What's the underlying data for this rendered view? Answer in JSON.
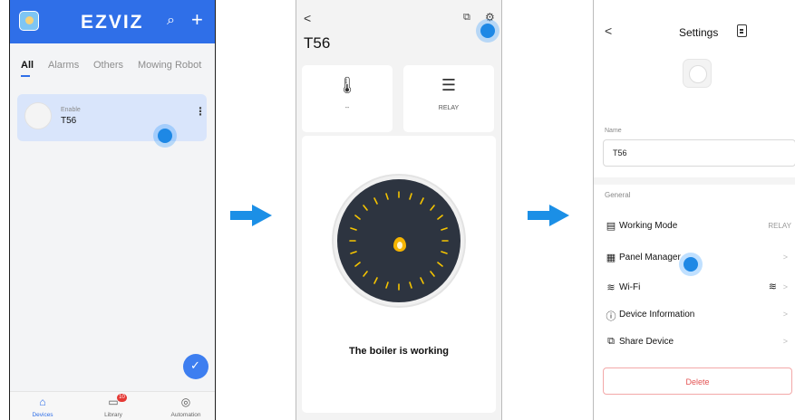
{
  "screen1": {
    "logo": "EZVIZ",
    "search_icon": "search-icon",
    "add_icon": "plus-icon",
    "tabs": [
      "All",
      "Alarms",
      "Others",
      "Mowing Robot"
    ],
    "device": {
      "status": "Enable",
      "name": "T56",
      "more": "⋮"
    },
    "nav": [
      {
        "label": "Devices",
        "icon": "home-icon"
      },
      {
        "label": "Library",
        "icon": "library-icon",
        "badge": "10"
      },
      {
        "label": "Automation",
        "icon": "compass-icon"
      }
    ]
  },
  "screen2": {
    "back": "<",
    "title": "T56",
    "tiles": [
      {
        "icon": "thermometer-icon",
        "label": "--"
      },
      {
        "icon": "sliders-icon",
        "label": "RELAY"
      }
    ],
    "status": "The boiler is working"
  },
  "screen3": {
    "back": "<",
    "title": "Settings",
    "name_label": "Name",
    "name_value": "T56",
    "section": "General",
    "rows": [
      {
        "label": "Working Mode",
        "icon": "mode-icon",
        "value": "RELAY"
      },
      {
        "label": "Panel Manager",
        "icon": "panel-icon",
        "chevron": ">"
      },
      {
        "label": "Wi-Fi",
        "icon": "wifi-icon",
        "chevron": ">"
      },
      {
        "label": "Device Information",
        "icon": "info-icon",
        "chevron": ">"
      },
      {
        "label": "Share Device",
        "icon": "share-icon",
        "chevron": ">"
      }
    ],
    "delete_label": "Delete"
  },
  "colors": {
    "brand_blue": "#2f6fe8",
    "tap_blue": "#1e88e5",
    "arrow_blue": "#1b8fe6",
    "delete_red": "#e35353"
  }
}
